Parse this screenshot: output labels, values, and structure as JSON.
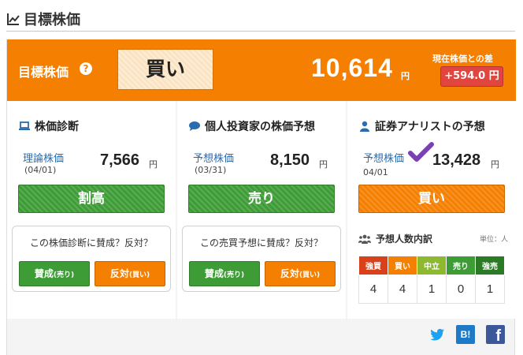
{
  "header": {
    "title": "目標株価",
    "icon": "line-chart-icon"
  },
  "banner": {
    "label": "目標株価",
    "help_icon": "?",
    "verdict": "買い",
    "price": "10,614",
    "unit": "円",
    "diff_label": "現在株価との差",
    "diff": "+594.0 円"
  },
  "cards": [
    {
      "title": "株価診断",
      "icon": "laptop-icon",
      "label": "理論株価",
      "date": "(04/01)",
      "value": "7,566",
      "unit": "円",
      "verdict": "割高",
      "vote_question": "この株価診断に賛成？反対？",
      "agree": "賛成",
      "agree_sub": "(売り)",
      "disagree": "反対",
      "disagree_sub": "(買い)"
    },
    {
      "title": "個人投資家の株価予想",
      "icon": "speech-bubble-icon",
      "label": "予想株価",
      "date": "(03/31)",
      "value": "8,150",
      "unit": "円",
      "verdict": "売り",
      "vote_question": "この売買予想に賛成？反対？",
      "agree": "賛成",
      "agree_sub": "(売り)",
      "disagree": "反対",
      "disagree_sub": "(買い)"
    },
    {
      "title": "証券アナリストの予想",
      "icon": "person-icon",
      "label": "予想株価",
      "date": "04/01",
      "value": "13,428",
      "unit": "円",
      "verdict": "買い",
      "breakdown_title": "予想人数内訳",
      "breakdown_unit": "単位：人",
      "breakdown_headers": [
        "強買",
        "買い",
        "中立",
        "売り",
        "強売"
      ],
      "breakdown_values": [
        "4",
        "4",
        "1",
        "0",
        "1"
      ]
    }
  ],
  "share": {
    "twitter": "twitter-icon",
    "hatena": "B!",
    "facebook": "f"
  },
  "colors": {
    "orange": "#f57f00",
    "green": "#3e9c37",
    "red": "#e0453e",
    "link": "#2b6cb0"
  }
}
